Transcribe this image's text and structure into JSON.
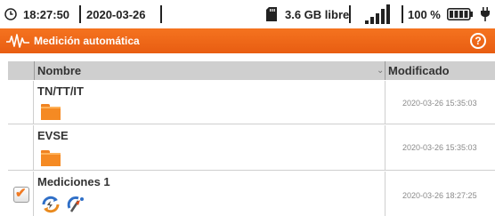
{
  "status": {
    "time": "18:27:50",
    "date": "2020-03-26",
    "storage": "3.6 GB libre",
    "battery_percent": "100 %",
    "signal_bars": 5,
    "battery_level": 1.0,
    "icons": [
      "clock-icon",
      "sd-card-icon",
      "signal-icon",
      "battery-icon",
      "plug-icon"
    ]
  },
  "titlebar": {
    "title": "Medición automática",
    "help": "?",
    "icon": "waveform-icon",
    "color": "#f26a1b"
  },
  "table": {
    "headers": {
      "name": "Nombre",
      "modified": "Modificado"
    },
    "sort_icon": "chevron-down-icon",
    "rows": [
      {
        "name": "TN/TT/IT",
        "modified": "2020-03-26 15:35:03",
        "checked": false,
        "icon": "folder-icon"
      },
      {
        "name": "EVSE",
        "modified": "2020-03-26 15:35:03",
        "checked": false,
        "icon": "folder-icon"
      },
      {
        "name": "Mediciones 1",
        "modified": "2020-03-26 18:27:25",
        "checked": true,
        "icons": [
          "auto-measurement-icon",
          "probe-icon"
        ]
      }
    ]
  }
}
